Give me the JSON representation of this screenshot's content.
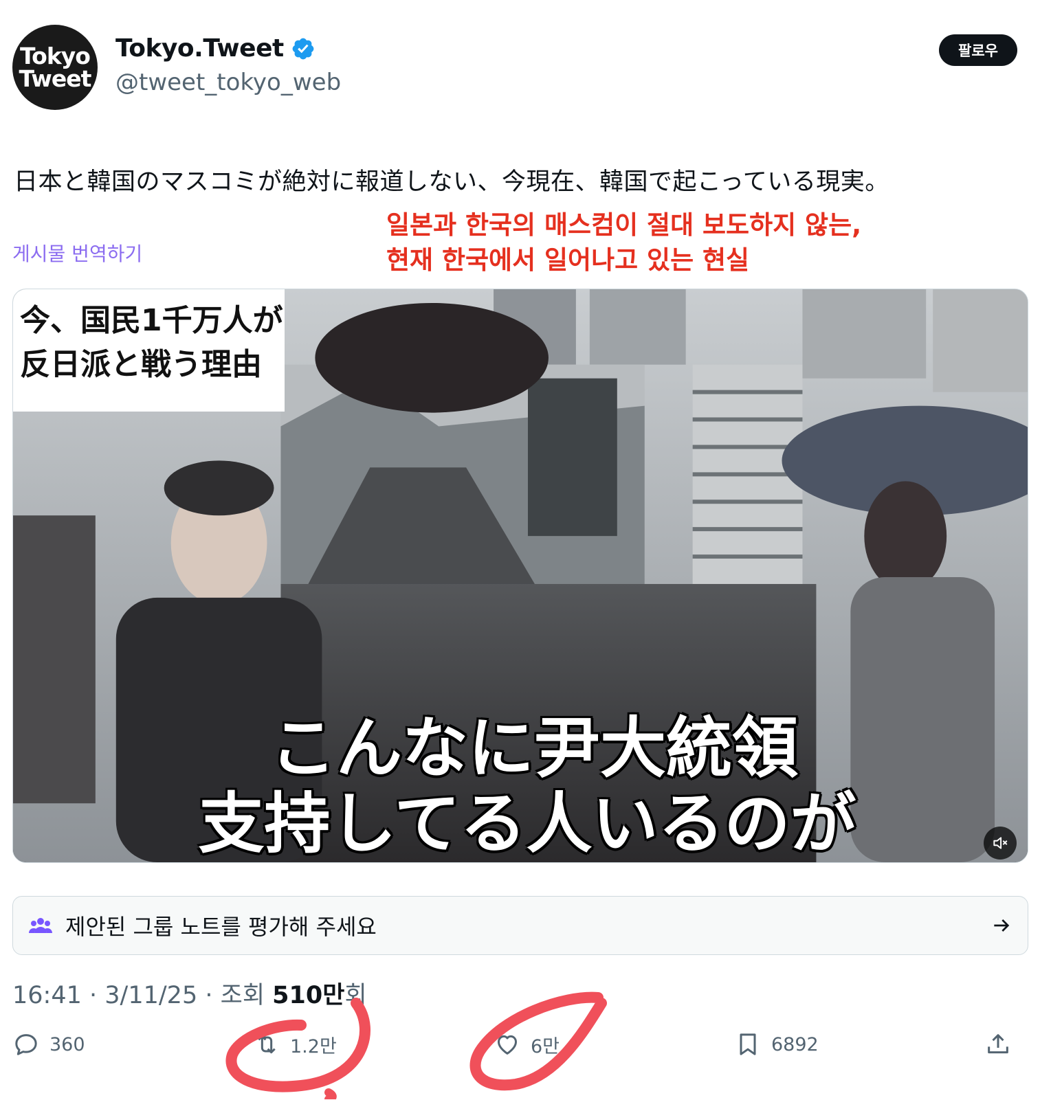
{
  "author": {
    "avatar_line1": "Tokyo",
    "avatar_line2": "Tweet",
    "display_name": "Tokyo.Tweet",
    "handle": "@tweet_tokyo_web",
    "verified_color": "#1d9bf0"
  },
  "follow_label": "팔로우",
  "tweet": {
    "text": "日本と韓国のマスコミが絶対に報道しない、今現在、韓国で起こっている現実。",
    "translate_label": "게시물 번역하기"
  },
  "annotation": {
    "line1": "일본과 한국의 매스컴이 절대 보도하지 않는,",
    "line2": "현재 한국에서 일어나고 있는 현실",
    "color": "#e5301f"
  },
  "media": {
    "caption_topleft_line1": "今、国民1千万人が",
    "caption_topleft_line2": "反日派と戦う理由",
    "caption_line1": "こんなに尹大統領",
    "caption_line2": "支持してる人いるのが",
    "mute_icon": "mute-icon"
  },
  "notes_prompt": "제안된 그룹 노트를 평가해 주세요",
  "meta": {
    "time": "16:41",
    "date": "3/11/25",
    "views_label": "조회",
    "views_value": "510만",
    "views_suffix": "회"
  },
  "actions": {
    "replies": "360",
    "reposts": "1.2만",
    "likes": "6만",
    "bookmarks": "6892"
  },
  "colors": {
    "accent_purple": "#8b6cf0",
    "scribble_red": "#f0505a"
  }
}
